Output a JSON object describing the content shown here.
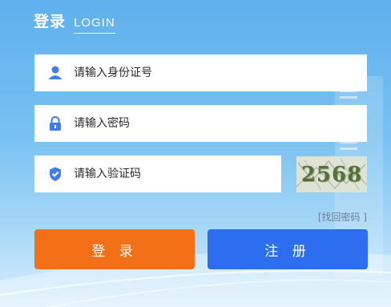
{
  "header": {
    "title_cn": "登录",
    "title_en": "LOGIN"
  },
  "form": {
    "id_field": {
      "placeholder": "请输入身份证号",
      "icon": "user-icon",
      "value": ""
    },
    "password_field": {
      "placeholder": "请输入密码",
      "icon": "lock-icon",
      "value": ""
    },
    "code_field": {
      "placeholder": "请输入验证码",
      "icon": "shield-check-icon",
      "value": ""
    },
    "captcha_text": "2568",
    "forgot_link": "[找回密码 ]",
    "login_button": "登 录",
    "register_button": "注 册"
  },
  "colors": {
    "accent_icon": "#3f7cf0",
    "login_button": "#f37018",
    "register_button": "#2d6ef0"
  }
}
